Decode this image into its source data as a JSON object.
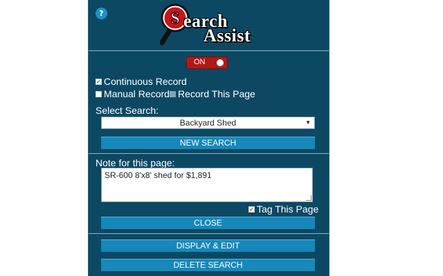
{
  "header": {
    "help_icon_label": "?",
    "logo_part1": "earch",
    "logo_part2": "Assist",
    "logo_letter": "S"
  },
  "toggle": {
    "label": "ON",
    "state": "on",
    "color": "#b21816"
  },
  "recording": {
    "continuous": {
      "label": "Continuous Record",
      "checked": true
    },
    "manual": {
      "label": "Manual Record",
      "checked": false
    },
    "this_page": {
      "label": "Record This Page",
      "checked": false
    }
  },
  "search": {
    "select_label": "Select Search:",
    "selected": "Backyard Shed",
    "new_button": "NEW SEARCH"
  },
  "note": {
    "label": "Note for this page:",
    "value": "SR-600 8'x8' shed for $1,891",
    "tag_label": "Tag This Page",
    "tag_checked": true,
    "close_button": "CLOSE"
  },
  "footer": {
    "display_button": "DISPLAY & EDIT",
    "delete_button": "DELETE SEARCH"
  },
  "colors": {
    "panel_bg": "#0d4863",
    "button_bg": "#1688b9",
    "accent_red": "#b21816"
  }
}
